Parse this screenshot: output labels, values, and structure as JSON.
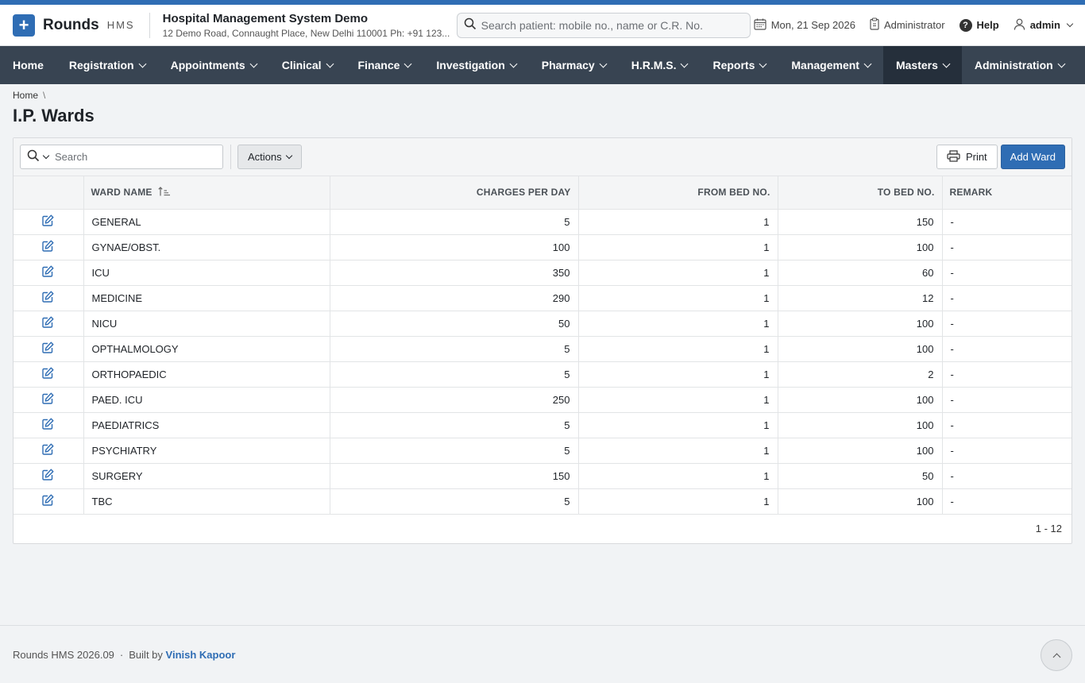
{
  "header": {
    "brand": "Rounds",
    "brand_sub": "HMS",
    "hospital_name": "Hospital Management System Demo",
    "hospital_address": "12 Demo Road, Connaught Place, New Delhi 110001 Ph: +91 123...",
    "search_placeholder": "Search patient: mobile no., name or C.R. No.",
    "date": "Mon, 21 Sep 2026",
    "role": "Administrator",
    "help": "Help",
    "user": "admin"
  },
  "nav": {
    "items": [
      {
        "label": "Home"
      },
      {
        "label": "Registration"
      },
      {
        "label": "Appointments"
      },
      {
        "label": "Clinical"
      },
      {
        "label": "Finance"
      },
      {
        "label": "Investigation"
      },
      {
        "label": "Pharmacy"
      },
      {
        "label": "H.R.M.S."
      },
      {
        "label": "Reports"
      },
      {
        "label": "Management"
      },
      {
        "label": "Masters"
      },
      {
        "label": "Administration"
      }
    ]
  },
  "breadcrumb": {
    "home": "Home",
    "separator": "\\"
  },
  "page": {
    "title": "I.P. Wards"
  },
  "toolbar": {
    "search_placeholder": "Search",
    "actions": "Actions",
    "print": "Print",
    "add": "Add Ward"
  },
  "table": {
    "headers": {
      "ward_name": "WARD NAME",
      "charges": "CHARGES PER DAY",
      "from_bed": "FROM BED NO.",
      "to_bed": "TO BED NO.",
      "remark": "REMARK"
    },
    "rows": [
      {
        "name": "GENERAL",
        "charges": "5",
        "from": "1",
        "to": "150",
        "remark": "-"
      },
      {
        "name": "GYNAE/OBST.",
        "charges": "100",
        "from": "1",
        "to": "100",
        "remark": "-"
      },
      {
        "name": "ICU",
        "charges": "350",
        "from": "1",
        "to": "60",
        "remark": "-"
      },
      {
        "name": "MEDICINE",
        "charges": "290",
        "from": "1",
        "to": "12",
        "remark": "-"
      },
      {
        "name": "NICU",
        "charges": "50",
        "from": "1",
        "to": "100",
        "remark": "-"
      },
      {
        "name": "OPTHALMOLOGY",
        "charges": "5",
        "from": "1",
        "to": "100",
        "remark": "-"
      },
      {
        "name": "ORTHOPAEDIC",
        "charges": "5",
        "from": "1",
        "to": "2",
        "remark": "-"
      },
      {
        "name": "PAED. ICU",
        "charges": "250",
        "from": "1",
        "to": "100",
        "remark": "-"
      },
      {
        "name": "PAEDIATRICS",
        "charges": "5",
        "from": "1",
        "to": "100",
        "remark": "-"
      },
      {
        "name": "PSYCHIATRY",
        "charges": "5",
        "from": "1",
        "to": "100",
        "remark": "-"
      },
      {
        "name": "SURGERY",
        "charges": "150",
        "from": "1",
        "to": "50",
        "remark": "-"
      },
      {
        "name": "TBC",
        "charges": "5",
        "from": "1",
        "to": "100",
        "remark": "-"
      }
    ],
    "pagination": "1 - 12"
  },
  "footer": {
    "version": "Rounds HMS 2026.09",
    "separator": "·",
    "built_by": "Built by",
    "author": "Vinish Kapoor"
  },
  "colors": {
    "brand": "#2f6db4",
    "nav_bg": "#384452",
    "nav_active": "#252f3b"
  },
  "icons": [
    "plus-icon",
    "search-icon",
    "calendar-icon",
    "clipboard-icon",
    "help-icon",
    "user-icon",
    "chevron-down-icon",
    "sort-ascending-icon",
    "edit-icon",
    "printer-icon",
    "chevron-up-icon"
  ]
}
